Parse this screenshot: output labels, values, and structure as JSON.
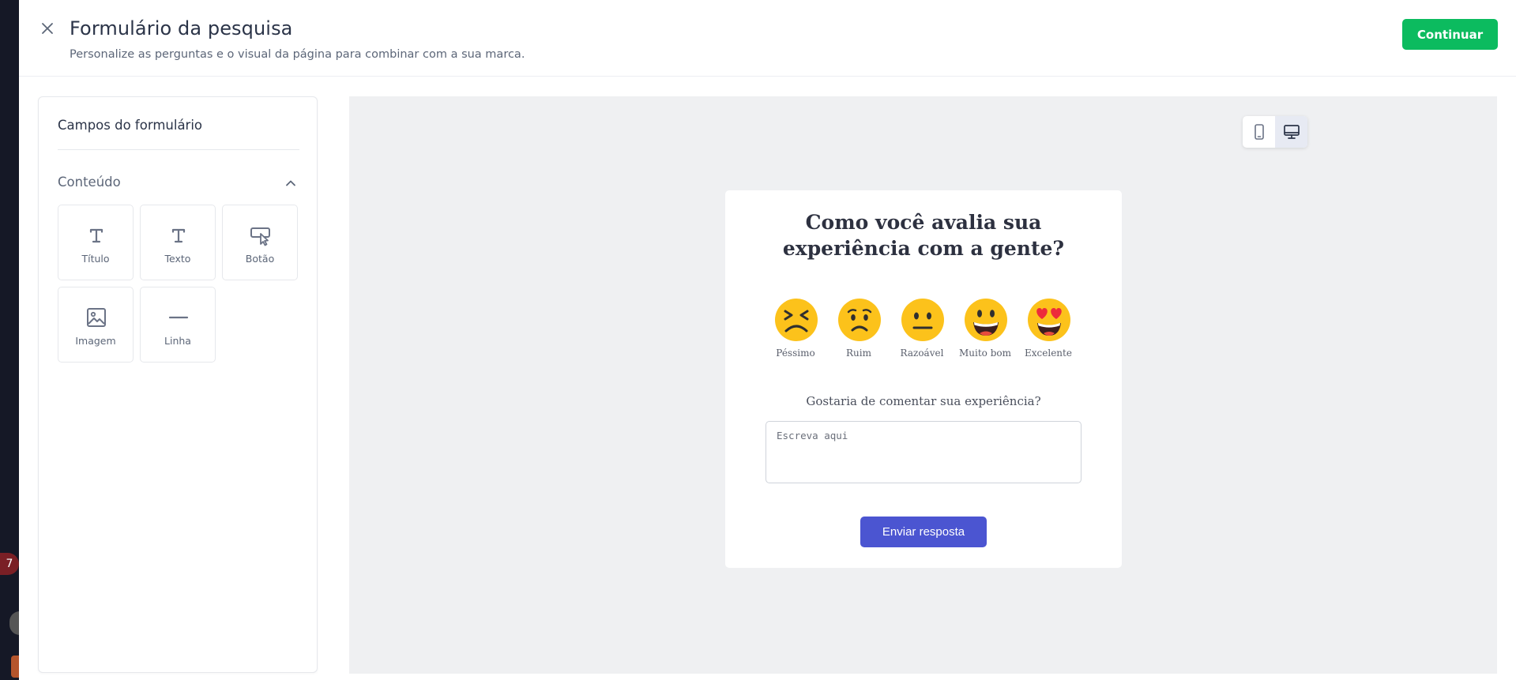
{
  "header": {
    "title": "Formulário da pesquisa",
    "subtitle": "Personalize as perguntas e o visual da página para combinar com a sua marca.",
    "continue_label": "Continuar"
  },
  "background": {
    "badge_count": "7"
  },
  "sidebar": {
    "title": "Campos do formulário",
    "section": {
      "label": "Conteúdo",
      "items": [
        {
          "label": "Título",
          "icon": "title-icon"
        },
        {
          "label": "Texto",
          "icon": "text-icon"
        },
        {
          "label": "Botão",
          "icon": "button-icon"
        },
        {
          "label": "Imagem",
          "icon": "image-icon"
        },
        {
          "label": "Linha",
          "icon": "line-icon"
        }
      ]
    }
  },
  "preview": {
    "device_options": [
      "mobile",
      "desktop"
    ],
    "selected_device": "desktop",
    "survey": {
      "question": "Como você avalia sua experiência com a gente?",
      "ratings": [
        {
          "label": "Péssimo",
          "icon": "persevering-face-icon"
        },
        {
          "label": "Ruim",
          "icon": "frowning-face-icon"
        },
        {
          "label": "Razoável",
          "icon": "neutral-face-icon"
        },
        {
          "label": "Muito bom",
          "icon": "grinning-face-icon"
        },
        {
          "label": "Excelente",
          "icon": "heart-eyes-face-icon"
        }
      ],
      "comment_label": "Gostaria de comentar sua experiência?",
      "comment_placeholder": "Escreva aqui",
      "comment_value": "",
      "submit_label": "Enviar resposta"
    }
  },
  "colors": {
    "primary_green": "#0cbb5f",
    "submit_blue": "#4b55d1",
    "preview_bg": "#eff0f2",
    "text_dark": "#2b3448",
    "emoji_yellow": "#fcc21b"
  }
}
